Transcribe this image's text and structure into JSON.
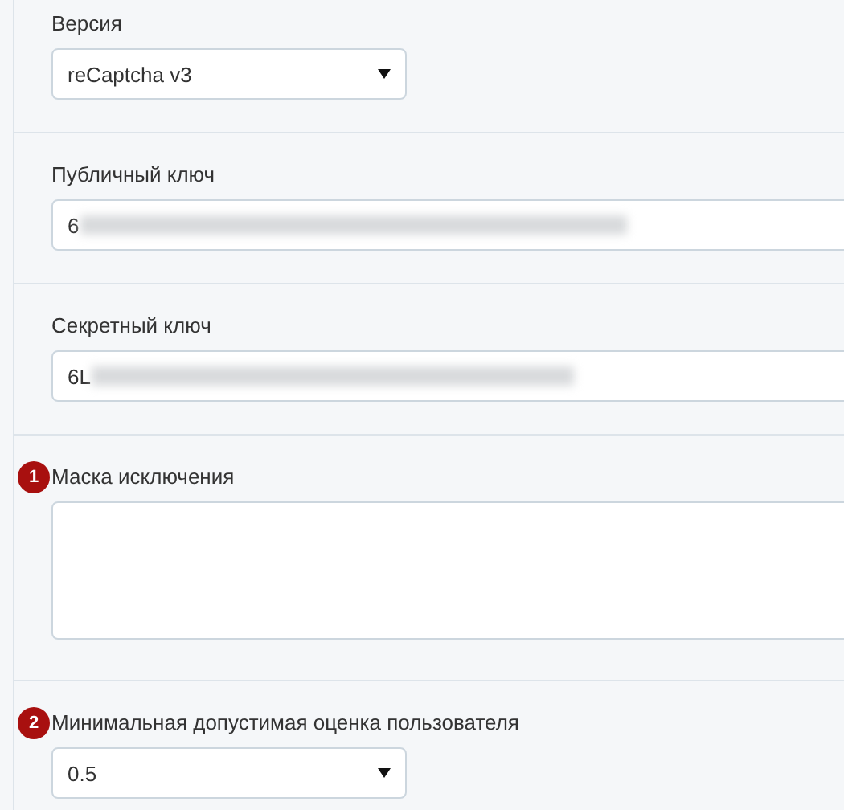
{
  "fields": [
    {
      "kind": "select",
      "label": "Версия",
      "value": "reCaptcha v3"
    },
    {
      "kind": "text",
      "label": "Публичный ключ",
      "value": "6",
      "redacted": true
    },
    {
      "kind": "text",
      "label": "Секретный ключ",
      "value": "6L",
      "redacted": true
    },
    {
      "kind": "textarea",
      "label": "Маска исключения",
      "badge": "1"
    },
    {
      "kind": "select",
      "label": "Минимальная допустимая оценка пользователя",
      "value": "0.5",
      "badge": "2"
    }
  ]
}
